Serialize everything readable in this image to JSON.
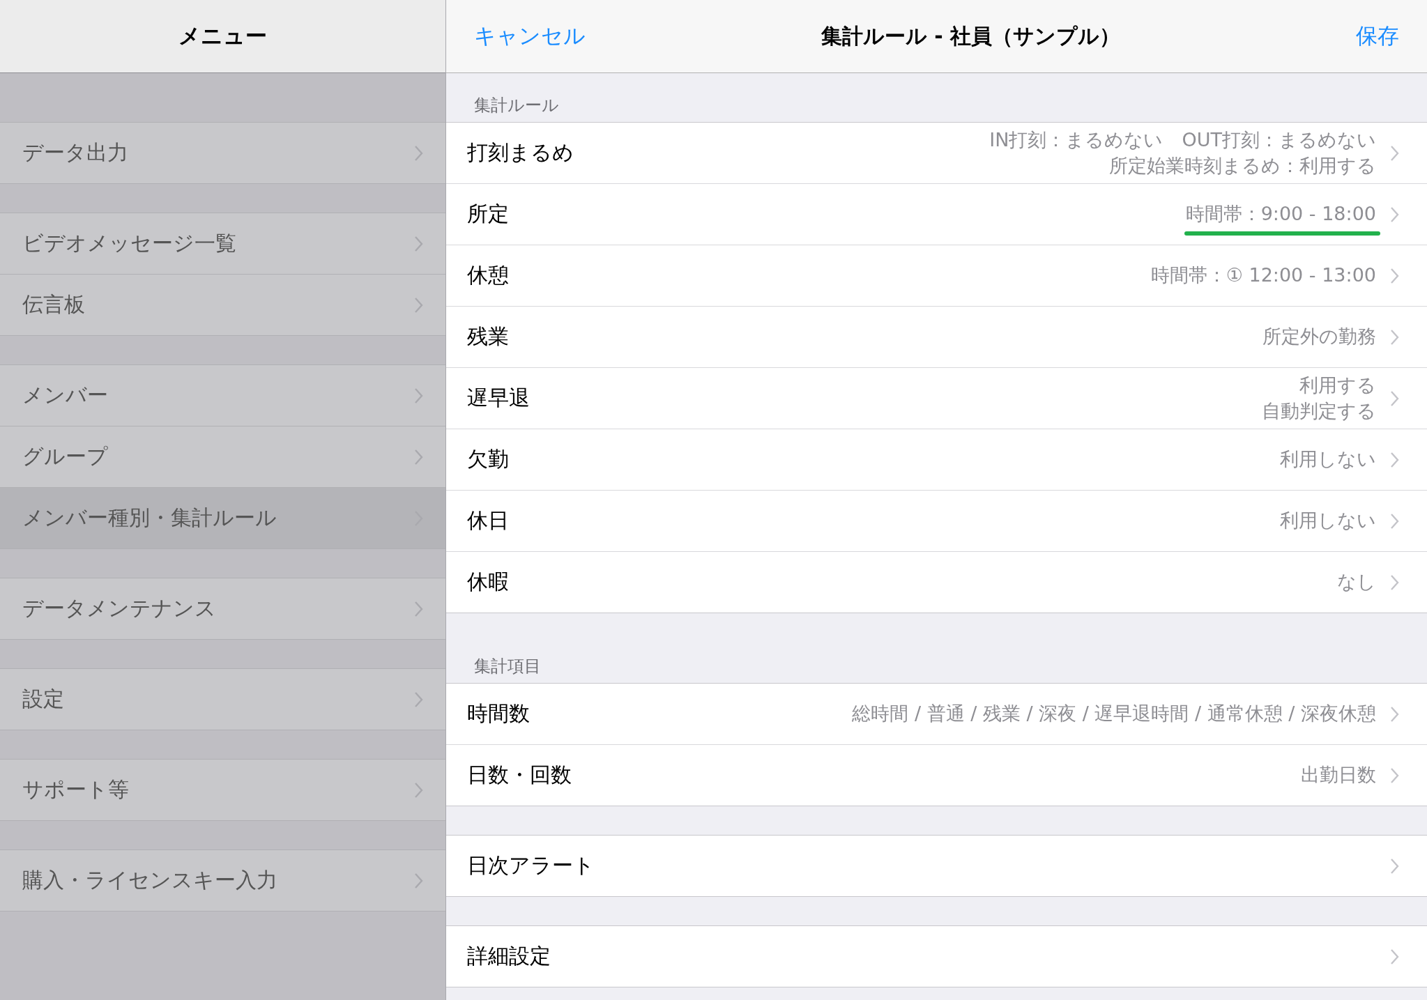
{
  "sidebar": {
    "title": "メニュー",
    "groups": [
      [
        {
          "label": "データ出力",
          "selected": false
        }
      ],
      [
        {
          "label": "ビデオメッセージ一覧",
          "selected": false
        },
        {
          "label": "伝言板",
          "selected": false
        }
      ],
      [
        {
          "label": "メンバー",
          "selected": false
        },
        {
          "label": "グループ",
          "selected": false
        },
        {
          "label": "メンバー種別・集計ルール",
          "selected": true
        }
      ],
      [
        {
          "label": "データメンテナンス",
          "selected": false
        }
      ],
      [
        {
          "label": "設定",
          "selected": false
        }
      ],
      [
        {
          "label": "サポート等",
          "selected": false
        }
      ],
      [
        {
          "label": "購入・ライセンスキー入力",
          "selected": false
        }
      ]
    ]
  },
  "nav": {
    "cancel": "キャンセル",
    "title": "集計ルール - 社員（サンプル）",
    "save": "保存"
  },
  "sections": [
    {
      "header": "集計ルール",
      "rows": [
        {
          "label": "打刻まるめ",
          "value": [
            "IN打刻：まるめない　OUT打刻：まるめない",
            "所定始業時刻まるめ：利用する"
          ],
          "underlined": false
        },
        {
          "label": "所定",
          "value": [
            "時間帯：9:00 - 18:00"
          ],
          "underlined": true
        },
        {
          "label": "休憩",
          "value": [
            "時間帯：① 12:00 - 13:00"
          ],
          "underlined": false
        },
        {
          "label": "残業",
          "value": [
            "所定外の勤務"
          ],
          "underlined": false
        },
        {
          "label": "遅早退",
          "value": [
            "利用する",
            "自動判定する"
          ],
          "underlined": false
        },
        {
          "label": "欠勤",
          "value": [
            "利用しない"
          ],
          "underlined": false
        },
        {
          "label": "休日",
          "value": [
            "利用しない"
          ],
          "underlined": false
        },
        {
          "label": "休暇",
          "value": [
            "なし"
          ],
          "underlined": false
        }
      ]
    },
    {
      "header": "集計項目",
      "rows": [
        {
          "label": "時間数",
          "value": [
            "総時間 / 普通 / 残業 / 深夜 / 遅早退時間 / 通常休憩 / 深夜休憩"
          ],
          "underlined": false
        },
        {
          "label": "日数・回数",
          "value": [
            "出勤日数"
          ],
          "underlined": false
        }
      ]
    },
    {
      "rows": [
        {
          "label": "日次アラート",
          "underlined": false
        }
      ]
    },
    {
      "rows": [
        {
          "label": "詳細設定",
          "underlined": false
        }
      ]
    }
  ]
}
